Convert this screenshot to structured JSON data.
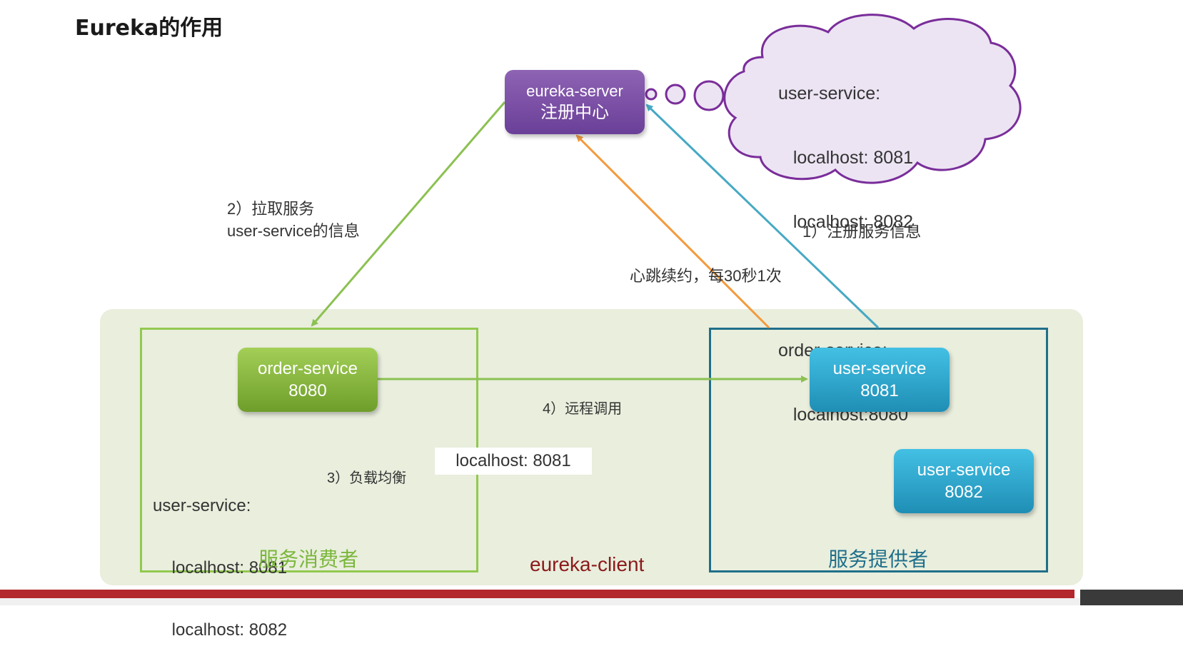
{
  "title": "Eureka的作用",
  "eureka_server": {
    "line1": "eureka-server",
    "line2": "注册中心"
  },
  "registry_cloud": {
    "lines": [
      "user-service:",
      "   localhost: 8081",
      "   localhost: 8082",
      "",
      "order-service:",
      "   localhost:8080"
    ]
  },
  "steps": {
    "pull": {
      "line1": "2）拉取服务",
      "line2": "user-service的信息"
    },
    "register": "1）注册服务信息",
    "heartbeat": "心跳续约，每30秒1次",
    "remote_call": "4）远程调用",
    "load_balance": "3）负载均衡"
  },
  "consumer": {
    "node": {
      "line1": "order-service",
      "line2": "8080"
    },
    "list": [
      "user-service:",
      "    localhost: 8081",
      "    localhost: 8082"
    ],
    "caption": "服务消费者"
  },
  "selected_instance": "localhost: 8081",
  "provider": {
    "node_8081": {
      "line1": "user-service",
      "line2": "8081"
    },
    "node_8082": {
      "line1": "user-service",
      "line2": "8082"
    },
    "caption": "服务提供者"
  },
  "client_caption": "eureka-client",
  "colors": {
    "server": "#7a4fa6",
    "consumer": "#8cc152",
    "provider": "#2aa5cf",
    "pull_arrow": "#8cc152",
    "register_arrow": "#46a9c4",
    "heartbeat_arrow": "#f39a3c",
    "cloud_fill": "#ece4f3",
    "cloud_stroke": "#7a2d9a"
  }
}
